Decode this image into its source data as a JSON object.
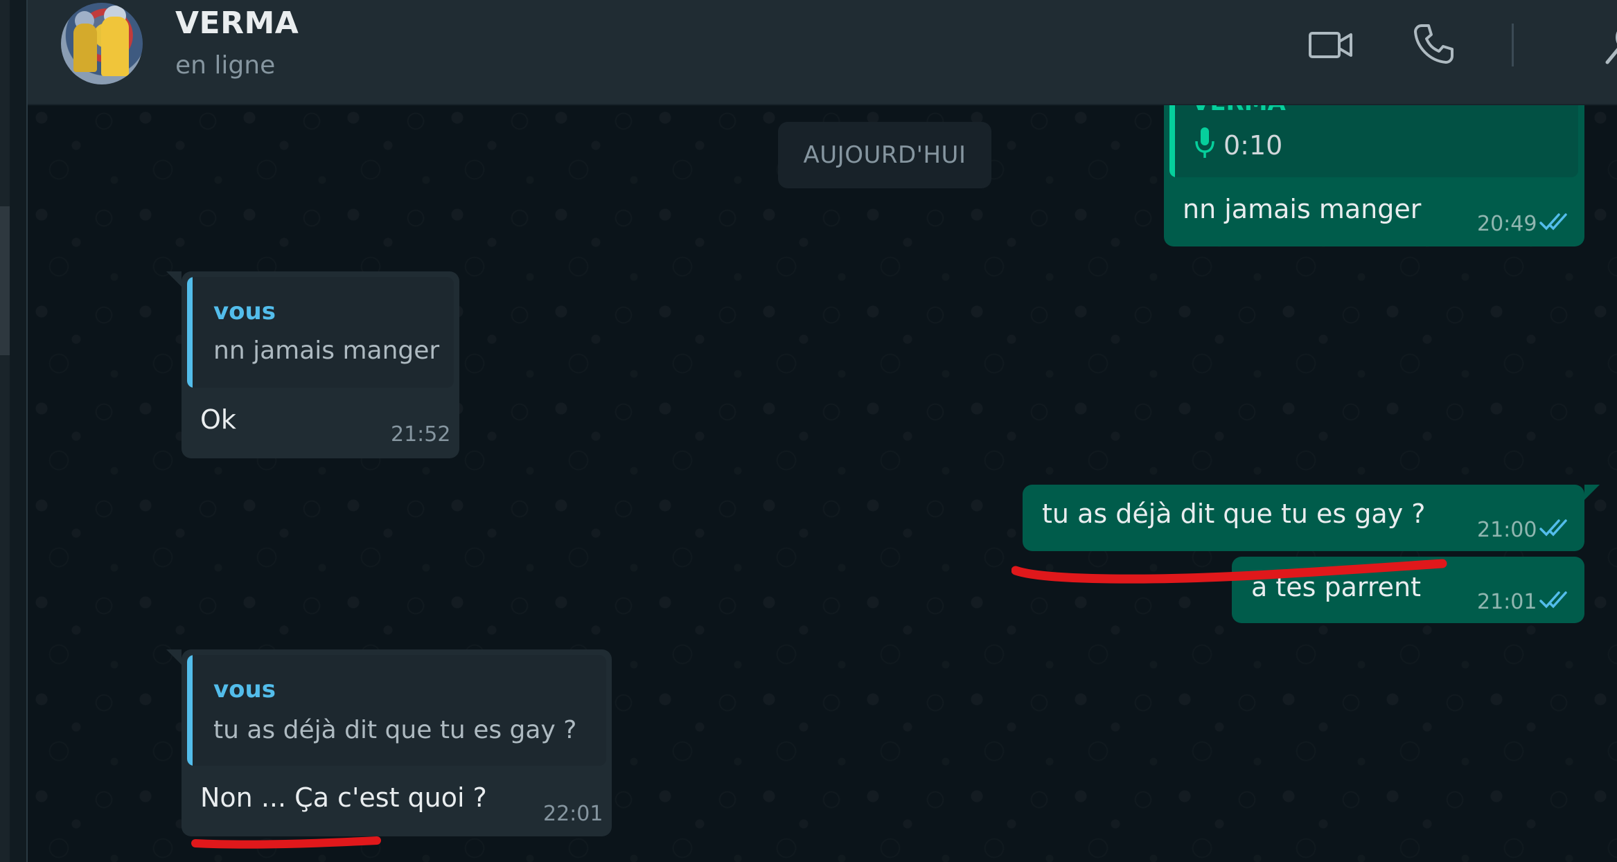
{
  "contact": {
    "name": "VERMA",
    "status": "en ligne"
  },
  "header_icons": [
    "video-call-icon",
    "voice-call-icon",
    "search-icon"
  ],
  "date_chip": "AUJOURD'HUI",
  "messages": [
    {
      "direction": "out",
      "quote": {
        "author": "VERMA",
        "voice_duration": "0:10"
      },
      "text": "nn jamais manger",
      "time": "20:49",
      "status": "read"
    },
    {
      "direction": "in",
      "quote": {
        "author": "vous",
        "text": "nn jamais manger"
      },
      "text": "Ok",
      "time": "21:52"
    },
    {
      "direction": "out",
      "text": "tu as déjà dit que tu es gay ?",
      "time": "21:00",
      "status": "read"
    },
    {
      "direction": "out",
      "text": "a tes parrent",
      "time": "21:01",
      "status": "read"
    },
    {
      "direction": "in",
      "quote": {
        "author": "vous",
        "text": "tu as déjà dit que tu es gay ?"
      },
      "text": "Non ... Ça c'est quoi ?",
      "time": "22:01"
    }
  ],
  "colors": {
    "header_bg": "#202c33",
    "chat_bg": "#0b141a",
    "incoming_bubble": "#202c33",
    "outgoing_bubble": "#005c4b",
    "quote_author_in": "#53bdeb",
    "quote_bar_out": "#06cf9c",
    "read_ticks": "#53bdeb",
    "annotation_red": "#e0181b"
  }
}
